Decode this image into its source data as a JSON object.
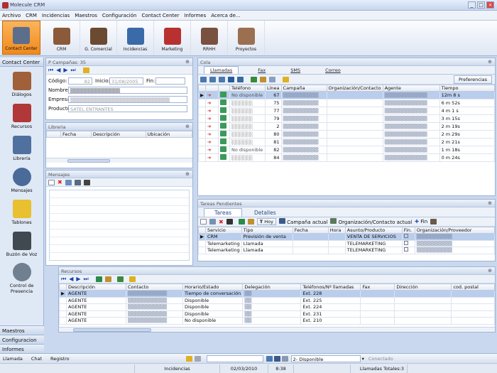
{
  "app": {
    "title": "Molecule CRM"
  },
  "menu": [
    "Archivo",
    "CRM",
    "Incidencias",
    "Maestros",
    "Configuración",
    "Contact Center",
    "Informes",
    "Acerca de..."
  ],
  "toolbar": [
    {
      "label": "Contact Center",
      "color": "#5b6e8c",
      "active": true
    },
    {
      "label": "CRM",
      "color": "#8a5a3a"
    },
    {
      "label": "G. Comercial",
      "color": "#6a4a30"
    },
    {
      "label": "Incidencias",
      "color": "#3a6aa8"
    },
    {
      "label": "Marketing",
      "color": "#b83030"
    },
    {
      "label": "RRHH",
      "color": "#7a5040"
    },
    {
      "label": "Proyectos",
      "color": "#9a7050"
    }
  ],
  "sidebar": {
    "header": "Contact Center",
    "items": [
      {
        "label": "Diálogos",
        "color": "#a0603a"
      },
      {
        "label": "Recursos",
        "color": "#b03838"
      },
      {
        "label": "Librería",
        "color": "#5070a0"
      },
      {
        "label": "Mensajes",
        "color": "#4a6a9a"
      },
      {
        "label": "Tablones",
        "color": "#e8c030"
      },
      {
        "label": "Buzón de Voz",
        "color": "#404850"
      },
      {
        "label": "Control de Presencia",
        "color": "#708090"
      }
    ],
    "footer": [
      "Maestros",
      "Configuracion",
      "Informes"
    ]
  },
  "campanas": {
    "header": "P Campañas: 35",
    "codigo_label": "Código:",
    "codigo": "82",
    "inicio_label": "Inicio:",
    "inicio": "31/08/2005",
    "fin_label": "Fin:",
    "nombre_label": "Nombre",
    "empresa_label": "Empresa",
    "producto_label": "Producto:",
    "producto": "SATEL ENTRANTES"
  },
  "libreria": {
    "header": "Libreria",
    "columns": [
      "Fecha",
      "Descripción",
      "Ubicación"
    ]
  },
  "mensajes": {
    "header": "Mensajes"
  },
  "cola": {
    "header": "Cola",
    "tabs": [
      "Llamadas",
      "Fax",
      "SMS",
      "Correo"
    ],
    "preferencias": "Preferencias",
    "columns": [
      "Teléfono",
      "Línea",
      "Campaña",
      "Organización/Contacto",
      "Agente",
      "Tiempo"
    ],
    "rows": [
      {
        "tel": "No disponible",
        "linea": "67",
        "tiempo": "12m 8 s"
      },
      {
        "tel": "",
        "linea": "75",
        "tiempo": "6 m 52s"
      },
      {
        "tel": "",
        "linea": "77",
        "tiempo": "4 m 1 s"
      },
      {
        "tel": "",
        "linea": "79",
        "tiempo": "3 m 15s"
      },
      {
        "tel": "",
        "linea": "2",
        "tiempo": "2 m 19s"
      },
      {
        "tel": "",
        "linea": "80",
        "tiempo": "2 m 29s"
      },
      {
        "tel": "",
        "linea": "81",
        "tiempo": "2 m 21s"
      },
      {
        "tel": "No disponible",
        "linea": "82",
        "tiempo": "1 m 18s"
      },
      {
        "tel": "",
        "linea": "84",
        "tiempo": "0 m 24s"
      }
    ]
  },
  "tareas": {
    "header": "Tareas Pendientes",
    "tabs": [
      "Tareas",
      "Detalles"
    ],
    "hoy": "Hoy",
    "campana_actual": "Campaña actual",
    "org_actual": "Organización/Contacto actual",
    "fin": "Fin",
    "columns": [
      "Servicio",
      "Tipo",
      "Fecha",
      "Hora",
      "Asunto/Producto",
      "Fin.",
      "Organización/Proveedor"
    ],
    "rows": [
      {
        "servicio": "CRM",
        "tipo": "Previsión de venta",
        "asunto": "VENTA DE SERVICIOS"
      },
      {
        "servicio": "Telemarketing",
        "tipo": "Llamada",
        "asunto": "TELEMARKETING"
      },
      {
        "servicio": "Telemarketing",
        "tipo": "Llamada",
        "asunto": "TELEMARKETING"
      }
    ]
  },
  "recursos": {
    "header": "Recursos",
    "columns": [
      "Descripción",
      "Contacto",
      "Horario/Estado",
      "Delegación",
      "Teléfonos/Nº llamadas",
      "Fax",
      "Dirección",
      "cod. postal"
    ],
    "rows": [
      {
        "desc": "AGENTE",
        "estado": "Tiempo de conversación",
        "tel": "Ext. 228"
      },
      {
        "desc": "AGENTE",
        "estado": "Disponible",
        "tel": "Ext. 225"
      },
      {
        "desc": "AGENTE",
        "estado": "Disponible",
        "tel": "Ext. 224"
      },
      {
        "desc": "AGENTE",
        "estado": "Disponible",
        "tel": "Ext. 231"
      },
      {
        "desc": "AGENTE",
        "estado": "No disponible",
        "tel": "Ext. 210"
      }
    ]
  },
  "status": {
    "llamada": "Llamada",
    "chat": "Chat",
    "registro": "Registro",
    "estado": "2- Disponible",
    "conectado": "Conectado"
  },
  "status2": {
    "incidencias": "Incidencias",
    "fecha": "02/03/2010",
    "hora": "8:38",
    "totales": "Llamadas Totales:3"
  }
}
